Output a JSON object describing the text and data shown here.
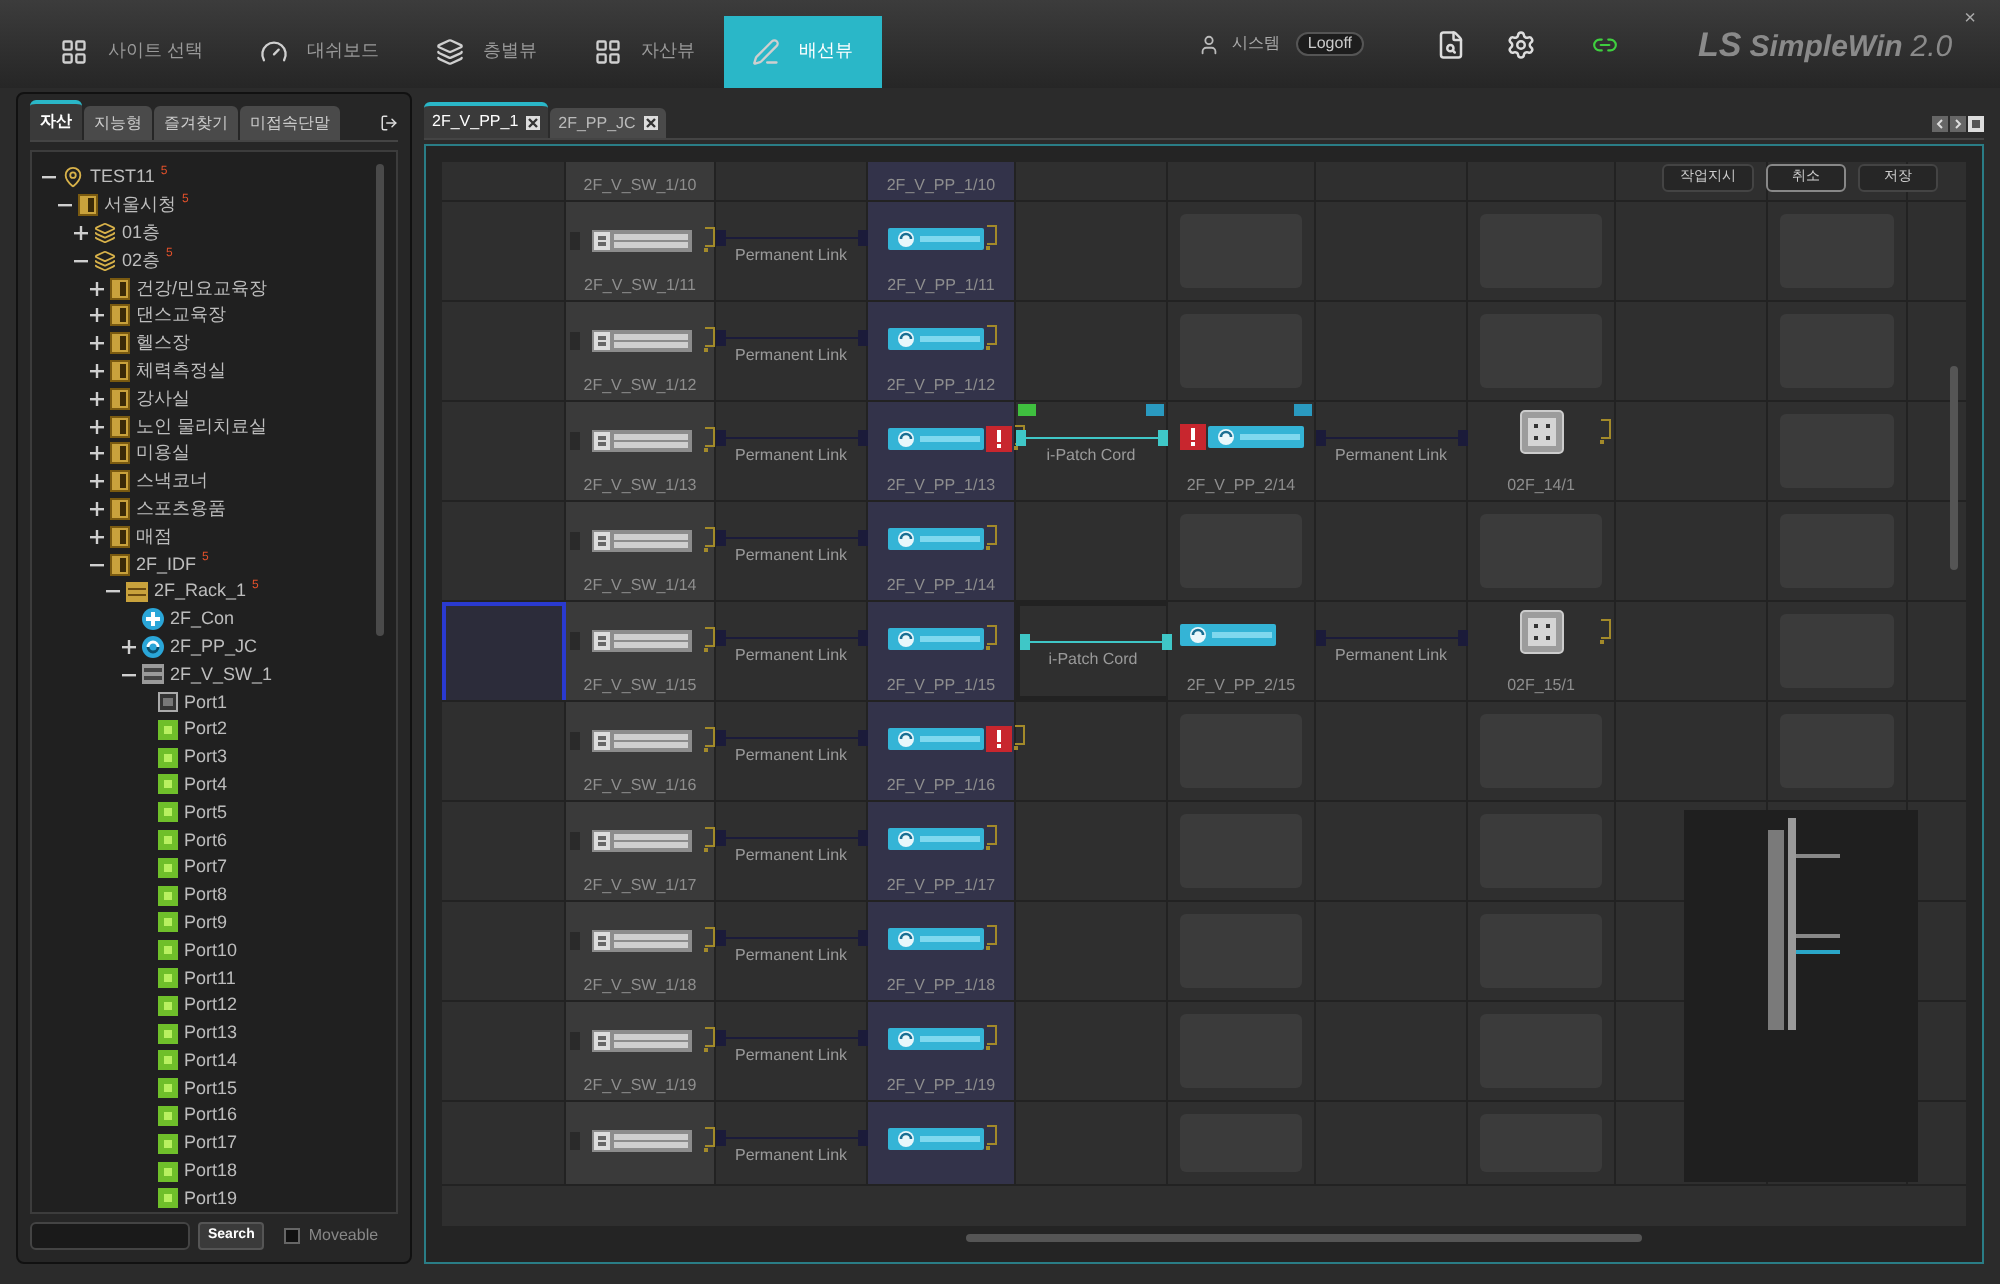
{
  "nav": [
    {
      "kind": "site",
      "label": "사이트 선택",
      "selected": false
    },
    {
      "kind": "dashboard",
      "label": "대쉬보드",
      "selected": false
    },
    {
      "kind": "floor",
      "label": "층별뷰",
      "selected": false
    },
    {
      "kind": "asset",
      "label": "자산뷰",
      "selected": false
    },
    {
      "kind": "wiring",
      "label": "배선뷰",
      "selected": true
    }
  ],
  "header": {
    "user": "시스템",
    "logoff": "Logoff",
    "logo_brand": "LS",
    "logo_product": "SimpleWin",
    "logo_version": "2.0",
    "close": "×"
  },
  "left_panel": {
    "tabs": [
      {
        "label": "자산",
        "selected": true
      },
      {
        "label": "지능형",
        "selected": false
      },
      {
        "label": "즐겨찾기",
        "selected": false
      },
      {
        "label": "미접속단말",
        "selected": false
      }
    ],
    "tree": [
      {
        "kind": "site",
        "label": "TEST11",
        "badge": "5",
        "expanded": true,
        "children": [
          {
            "kind": "building",
            "label": "서울시청",
            "badge": "5",
            "expanded": true,
            "children": [
              {
                "kind": "floor",
                "label": "01층",
                "expanded": false
              },
              {
                "kind": "floor",
                "label": "02층",
                "badge": "5",
                "expanded": true,
                "children": [
                  {
                    "kind": "room",
                    "label": "건강/민요교육장",
                    "expanded": false
                  },
                  {
                    "kind": "room",
                    "label": "댄스교육장",
                    "expanded": false
                  },
                  {
                    "kind": "room",
                    "label": "헬스장",
                    "expanded": false
                  },
                  {
                    "kind": "room",
                    "label": "체력측정실",
                    "expanded": false
                  },
                  {
                    "kind": "room",
                    "label": "강사실",
                    "expanded": false
                  },
                  {
                    "kind": "room",
                    "label": "노인 물리치료실",
                    "expanded": false
                  },
                  {
                    "kind": "room",
                    "label": "미용실",
                    "expanded": false
                  },
                  {
                    "kind": "room",
                    "label": "스낵코너",
                    "expanded": false
                  },
                  {
                    "kind": "room",
                    "label": "스포츠용품",
                    "expanded": false
                  },
                  {
                    "kind": "room",
                    "label": "매점",
                    "expanded": false
                  },
                  {
                    "kind": "room",
                    "label": "2F_IDF",
                    "badge": "5",
                    "expanded": true,
                    "children": [
                      {
                        "kind": "rack",
                        "label": "2F_Rack_1",
                        "badge": "5",
                        "expanded": true,
                        "children": [
                          {
                            "kind": "console",
                            "label": "2F_Con"
                          },
                          {
                            "kind": "patchpanel",
                            "label": "2F_PP_JC",
                            "expanded": false
                          },
                          {
                            "kind": "switch",
                            "label": "2F_V_SW_1",
                            "expanded": true,
                            "children": [
                              {
                                "kind": "port",
                                "label": "Port1",
                                "active": false
                              },
                              {
                                "kind": "port",
                                "label": "Port2",
                                "active": true
                              },
                              {
                                "kind": "port",
                                "label": "Port3",
                                "active": true
                              },
                              {
                                "kind": "port",
                                "label": "Port4",
                                "active": true
                              },
                              {
                                "kind": "port",
                                "label": "Port5",
                                "active": true
                              },
                              {
                                "kind": "port",
                                "label": "Port6",
                                "active": true
                              },
                              {
                                "kind": "port",
                                "label": "Port7",
                                "active": true
                              },
                              {
                                "kind": "port",
                                "label": "Port8",
                                "active": true
                              },
                              {
                                "kind": "port",
                                "label": "Port9",
                                "active": true
                              },
                              {
                                "kind": "port",
                                "label": "Port10",
                                "active": true
                              },
                              {
                                "kind": "port",
                                "label": "Port11",
                                "active": true
                              },
                              {
                                "kind": "port",
                                "label": "Port12",
                                "active": true
                              },
                              {
                                "kind": "port",
                                "label": "Port13",
                                "active": true
                              },
                              {
                                "kind": "port",
                                "label": "Port14",
                                "active": true
                              },
                              {
                                "kind": "port",
                                "label": "Port15",
                                "active": true
                              },
                              {
                                "kind": "port",
                                "label": "Port16",
                                "active": true
                              },
                              {
                                "kind": "port",
                                "label": "Port17",
                                "active": true
                              },
                              {
                                "kind": "port",
                                "label": "Port18",
                                "active": true
                              },
                              {
                                "kind": "port",
                                "label": "Port19",
                                "active": true
                              }
                            ]
                          }
                        ]
                      }
                    ]
                  }
                ]
              }
            ]
          }
        ]
      }
    ],
    "search_button": "Search",
    "moveable": {
      "label": "Moveable",
      "checked": false
    }
  },
  "main": {
    "tabs": [
      {
        "label": "2F_V_PP_1",
        "selected": true
      },
      {
        "label": "2F_PP_JC",
        "selected": false
      }
    ],
    "actions": [
      "작업지시",
      "취소",
      "저장"
    ],
    "rows": [
      {
        "kind": "label_only",
        "selected": false,
        "switch": "2F_V_SW_1/10",
        "panel": "2F_V_PP_1/10"
      },
      {
        "kind": "full",
        "selected": false,
        "switch": "2F_V_SW_1/11",
        "link": "Permanent Link",
        "panel": "2F_V_PP_1/11",
        "alert": false
      },
      {
        "kind": "full",
        "selected": false,
        "switch": "2F_V_SW_1/12",
        "link": "Permanent Link",
        "panel": "2F_V_PP_1/12",
        "alert": false
      },
      {
        "kind": "full",
        "selected": false,
        "switch": "2F_V_SW_1/13",
        "link": "Permanent Link",
        "panel": "2F_V_PP_1/13",
        "alert": true,
        "patch": {
          "label": "i-Patch Cord",
          "selected": false
        },
        "panel2": {
          "label": "2F_V_PP_2/14",
          "alert": true
        },
        "link2": "Permanent Link",
        "outlet": "02F_14/1"
      },
      {
        "kind": "full",
        "selected": false,
        "switch": "2F_V_SW_1/14",
        "link": "Permanent Link",
        "panel": "2F_V_PP_1/14",
        "alert": false
      },
      {
        "kind": "full",
        "selected": true,
        "switch": "2F_V_SW_1/15",
        "link": "Permanent Link",
        "panel": "2F_V_PP_1/15",
        "alert": false,
        "patch": {
          "label": "i-Patch Cord",
          "selected": true
        },
        "panel2": {
          "label": "2F_V_PP_2/15",
          "alert": false
        },
        "link2": "Permanent Link",
        "outlet": "02F_15/1"
      },
      {
        "kind": "full",
        "selected": false,
        "switch": "2F_V_SW_1/16",
        "link": "Permanent Link",
        "panel": "2F_V_PP_1/16",
        "alert": true
      },
      {
        "kind": "full",
        "selected": false,
        "switch": "2F_V_SW_1/17",
        "link": "Permanent Link",
        "panel": "2F_V_PP_1/17",
        "alert": false
      },
      {
        "kind": "full",
        "selected": false,
        "switch": "2F_V_SW_1/18",
        "link": "Permanent Link",
        "panel": "2F_V_PP_1/18",
        "alert": false
      },
      {
        "kind": "full",
        "selected": false,
        "switch": "2F_V_SW_1/19",
        "link": "Permanent Link",
        "panel": "2F_V_PP_1/19",
        "alert": false
      },
      {
        "kind": "device_only",
        "selected": false,
        "link": "Permanent Link",
        "alert": false
      }
    ]
  }
}
